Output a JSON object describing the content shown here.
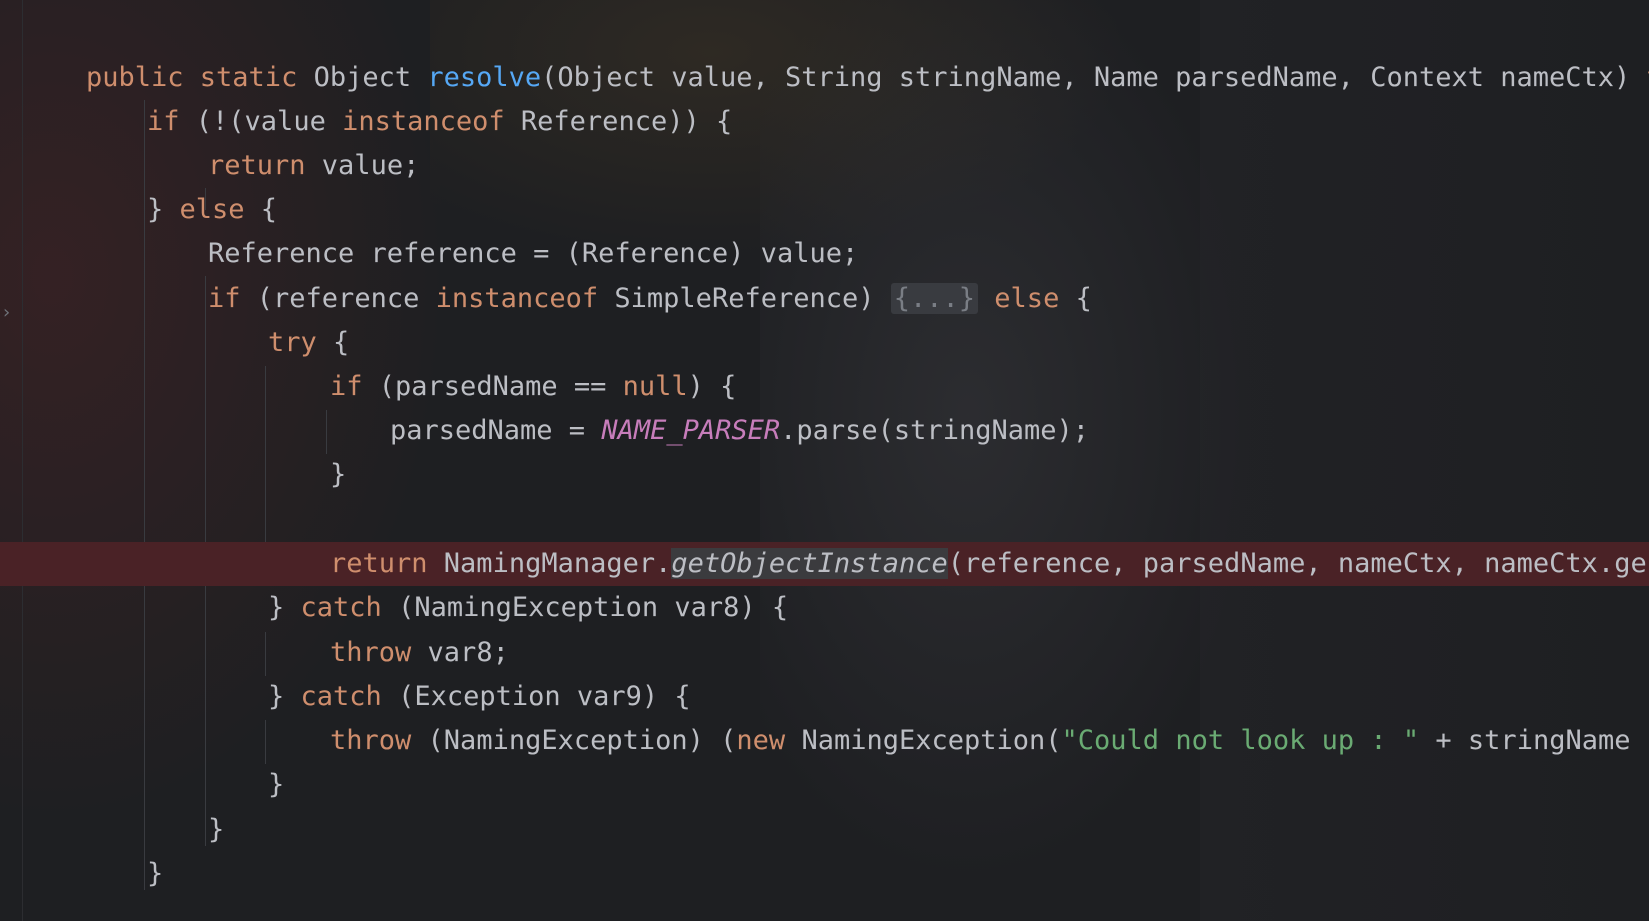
{
  "editor": {
    "lines": [
      {
        "parts": [
          {
            "t": "public static ",
            "c": "kw"
          },
          {
            "t": "Object ",
            "c": ""
          },
          {
            "t": "resolve",
            "c": "fn"
          },
          {
            "t": "(Object value, String stringName, Name parsedName, Context nameCtx) ",
            "c": ""
          },
          {
            "t": "th",
            "c": "kw"
          }
        ]
      },
      {
        "parts": [
          {
            "t": "if ",
            "c": "kw"
          },
          {
            "t": "(!(value ",
            "c": ""
          },
          {
            "t": "instanceof ",
            "c": "kw"
          },
          {
            "t": "Reference)) {",
            "c": ""
          }
        ]
      },
      {
        "parts": [
          {
            "t": "return ",
            "c": "kw"
          },
          {
            "t": "value;",
            "c": ""
          }
        ]
      },
      {
        "parts": [
          {
            "t": "} ",
            "c": ""
          },
          {
            "t": "else ",
            "c": "kw"
          },
          {
            "t": "{",
            "c": ""
          }
        ]
      },
      {
        "parts": [
          {
            "t": "Reference reference = (Reference) value;",
            "c": ""
          }
        ]
      },
      {
        "parts": [
          {
            "t": "if ",
            "c": "kw"
          },
          {
            "t": "(reference ",
            "c": ""
          },
          {
            "t": "instanceof ",
            "c": "kw"
          },
          {
            "t": "SimpleReference) ",
            "c": ""
          },
          {
            "t": "{...}",
            "c": "fold-box"
          },
          {
            "t": " ",
            "c": ""
          },
          {
            "t": "else ",
            "c": "kw"
          },
          {
            "t": "{",
            "c": ""
          }
        ]
      },
      {
        "parts": [
          {
            "t": "try ",
            "c": "kw"
          },
          {
            "t": "{",
            "c": ""
          }
        ]
      },
      {
        "parts": [
          {
            "t": "if ",
            "c": "kw"
          },
          {
            "t": "(parsedName == ",
            "c": ""
          },
          {
            "t": "null",
            "c": "kw"
          },
          {
            "t": ") {",
            "c": ""
          }
        ]
      },
      {
        "parts": [
          {
            "t": "parsedName = ",
            "c": ""
          },
          {
            "t": "NAME_PARSER",
            "c": "const"
          },
          {
            "t": ".parse(stringName);",
            "c": ""
          }
        ]
      },
      {
        "parts": [
          {
            "t": "}",
            "c": ""
          }
        ]
      },
      {
        "parts": [
          {
            "t": "return ",
            "c": "kw"
          },
          {
            "t": "NamingManager.",
            "c": ""
          },
          {
            "t": "getObjectInstance",
            "c": "call-hl"
          },
          {
            "t": "(reference, parsedName, nameCtx, nameCtx.ge",
            "c": ""
          }
        ]
      },
      {
        "parts": [
          {
            "t": "} ",
            "c": ""
          },
          {
            "t": "catch ",
            "c": "kw"
          },
          {
            "t": "(NamingException var8) {",
            "c": ""
          }
        ]
      },
      {
        "parts": [
          {
            "t": "throw ",
            "c": "kw"
          },
          {
            "t": "var8;",
            "c": ""
          }
        ]
      },
      {
        "parts": [
          {
            "t": "} ",
            "c": ""
          },
          {
            "t": "catch ",
            "c": "kw"
          },
          {
            "t": "(Exception var9) {",
            "c": ""
          }
        ]
      },
      {
        "parts": [
          {
            "t": "throw ",
            "c": "kw"
          },
          {
            "t": "(NamingException) (",
            "c": ""
          },
          {
            "t": "new ",
            "c": "kw"
          },
          {
            "t": "NamingException(",
            "c": ""
          },
          {
            "t": "\"Could not look up : \"",
            "c": "str"
          },
          {
            "t": " + stringName ",
            "c": ""
          }
        ]
      },
      {
        "parts": [
          {
            "t": "}",
            "c": ""
          }
        ]
      },
      {
        "parts": [
          {
            "t": "}",
            "c": ""
          }
        ]
      },
      {
        "parts": [
          {
            "t": "}",
            "c": ""
          }
        ]
      }
    ]
  },
  "colors": {
    "background": "#1e1f22",
    "keyword": "#cf8e6d",
    "function": "#56a8f5",
    "constant": "#c77dbb",
    "string": "#6aab73",
    "text": "#bcbec4",
    "breakpoint_line": "#4a2226"
  },
  "icons": {
    "fold": "chevron-right-icon"
  }
}
